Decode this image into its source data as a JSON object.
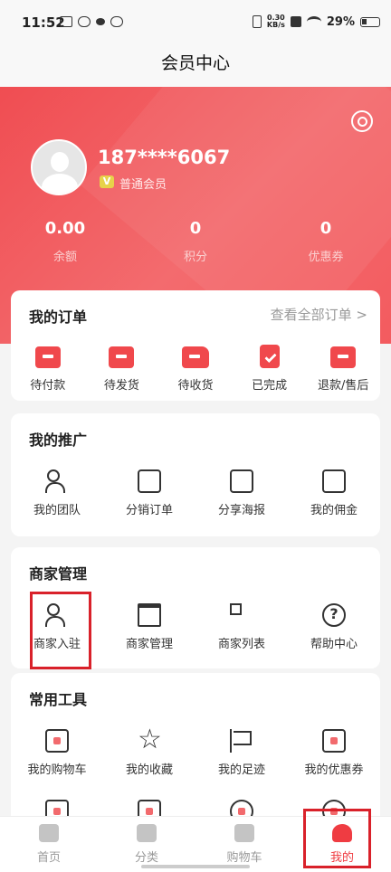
{
  "status_bar": {
    "time": "11:52",
    "speed_value": "0.30",
    "speed_unit": "KB/s",
    "battery": "29%"
  },
  "header": {
    "title": "会员中心"
  },
  "profile": {
    "phone": "187****6067",
    "badge_letter": "V",
    "level": "普通会员"
  },
  "stats": [
    {
      "value": "0.00",
      "label": "余额"
    },
    {
      "value": "0",
      "label": "积分"
    },
    {
      "value": "0",
      "label": "优惠券"
    }
  ],
  "orders": {
    "title": "我的订单",
    "view_all": "查看全部订单 >",
    "items": [
      {
        "label": "待付款",
        "icon": "wallet-icon"
      },
      {
        "label": "待发货",
        "icon": "box-icon"
      },
      {
        "label": "待收货",
        "icon": "truck-icon"
      },
      {
        "label": "已完成",
        "icon": "clipboard-check-icon"
      },
      {
        "label": "退款/售后",
        "icon": "refund-icon"
      }
    ]
  },
  "promotion": {
    "title": "我的推广",
    "items": [
      {
        "label": "我的团队",
        "icon": "team-icon"
      },
      {
        "label": "分销订单",
        "icon": "order-list-icon"
      },
      {
        "label": "分享海报",
        "icon": "poster-icon"
      },
      {
        "label": "我的佣金",
        "icon": "commission-icon"
      }
    ]
  },
  "merchant": {
    "title": "商家管理",
    "items": [
      {
        "label": "商家入驻",
        "icon": "merchant-join-icon"
      },
      {
        "label": "商家管理",
        "icon": "store-icon"
      },
      {
        "label": "商家列表",
        "icon": "grid-list-icon"
      },
      {
        "label": "帮助中心",
        "icon": "help-icon"
      }
    ]
  },
  "tools": {
    "title": "常用工具",
    "items": [
      {
        "label": "我的购物车",
        "icon": "cart-icon"
      },
      {
        "label": "我的收藏",
        "icon": "star-icon"
      },
      {
        "label": "我的足迹",
        "icon": "flag-icon"
      },
      {
        "label": "我的优惠券",
        "icon": "coupon-icon"
      }
    ]
  },
  "tabbar": [
    {
      "label": "首页",
      "icon": "home-icon"
    },
    {
      "label": "分类",
      "icon": "category-icon"
    },
    {
      "label": "购物车",
      "icon": "cart-icon"
    },
    {
      "label": "我的",
      "icon": "user-icon",
      "active": true
    }
  ],
  "colors": {
    "accent": "#ef3c42",
    "header_bg": "#f04d52",
    "highlight_box": "#d9212a"
  }
}
